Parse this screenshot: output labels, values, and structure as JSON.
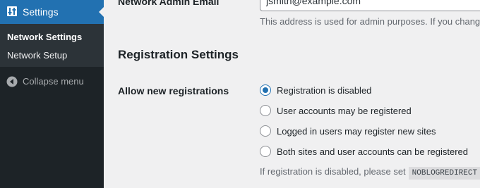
{
  "sidebar": {
    "current_menu": {
      "label": "Settings",
      "icon": "settings-icon"
    },
    "submenu": [
      {
        "label": "Network Settings",
        "active": true
      },
      {
        "label": "Network Setup",
        "active": false
      }
    ],
    "collapse": {
      "label": "Collapse menu",
      "icon": "collapse-arrow-icon"
    }
  },
  "main": {
    "admin_email": {
      "label": "Network Admin Email",
      "value": "jsmith@example.com",
      "description": "This address is used for admin purposes. If you change"
    },
    "registration": {
      "section_title": "Registration Settings",
      "label": "Allow new registrations",
      "options": [
        {
          "label": "Registration is disabled",
          "checked": true
        },
        {
          "label": "User accounts may be registered",
          "checked": false
        },
        {
          "label": "Logged in users may register new sites",
          "checked": false
        },
        {
          "label": "Both sites and user accounts can be registered",
          "checked": false
        }
      ],
      "note_text": "If registration is disabled, please set",
      "note_code": "NOBLOGREDIRECT"
    }
  },
  "colors": {
    "sidebar_bg": "#1d2327",
    "accent": "#2271b1",
    "page_bg": "#f0f0f1"
  }
}
